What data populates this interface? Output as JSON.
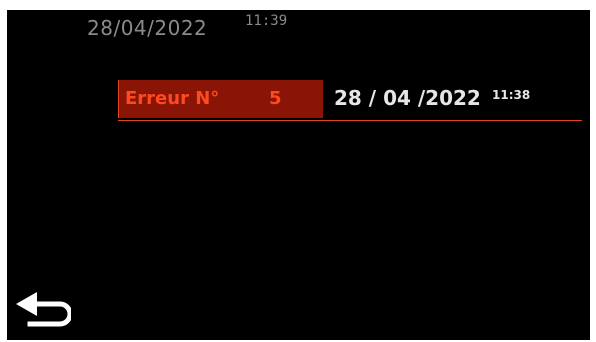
{
  "header": {
    "date": "28/04/2022",
    "time": "11:39"
  },
  "error_entry": {
    "label": "Erreur N°",
    "number": "5",
    "date": "28 / 04 /2022",
    "time": "11:38"
  },
  "colors": {
    "background": "#000000",
    "accent": "#ff4a1f",
    "label_bg": "#8a1506",
    "header_text": "#8a8a8a",
    "entry_text": "#e6e6e6"
  },
  "icons": {
    "back": "back-arrow-icon"
  }
}
